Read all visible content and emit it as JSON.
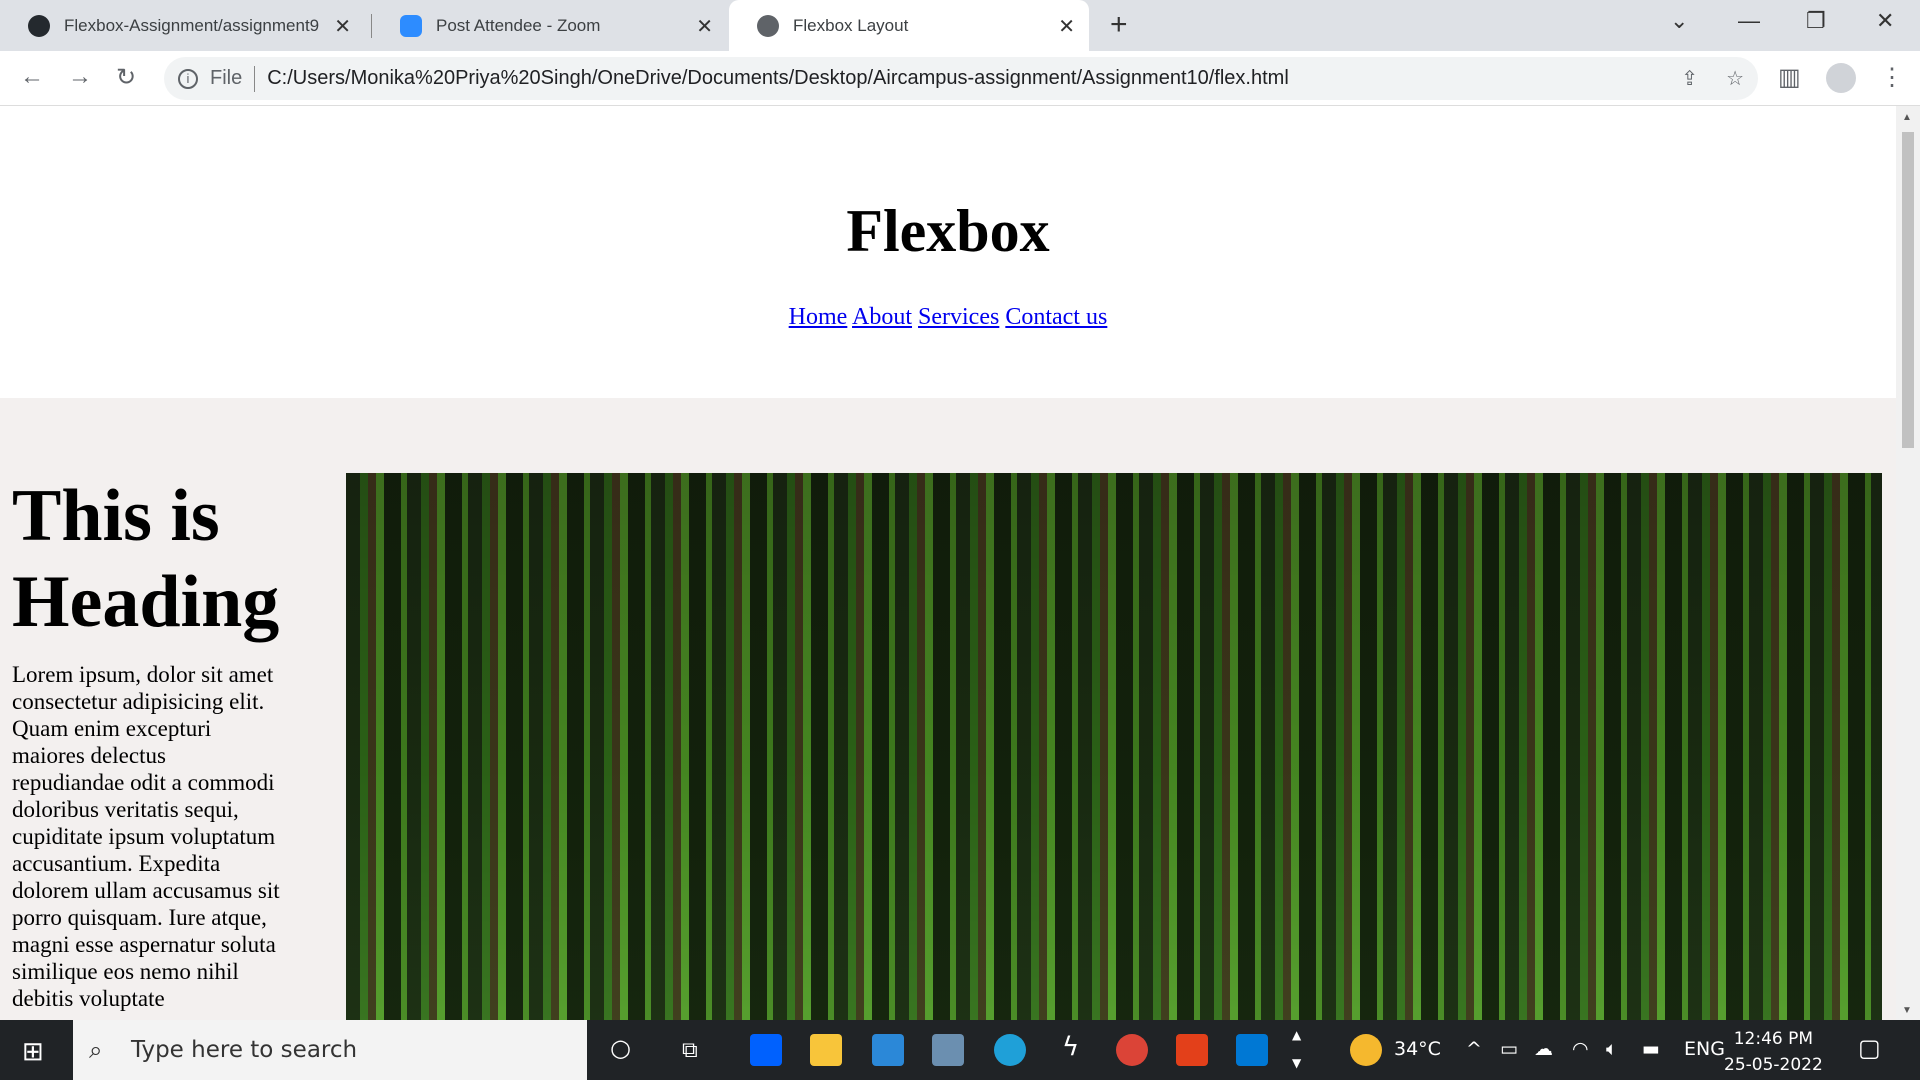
{
  "browser": {
    "tabs": [
      {
        "title": "Flexbox-Assignment/assignment9",
        "icon": "github-icon"
      },
      {
        "title": "Post Attendee - Zoom",
        "icon": "zoom-icon"
      },
      {
        "title": "Flexbox Layout",
        "icon": "globe-icon",
        "active": true
      }
    ],
    "url_scheme": "File",
    "url": "C:/Users/Monika%20Priya%20Singh/OneDrive/Documents/Desktop/Aircampus-assignment/Assignment10/flex.html"
  },
  "page": {
    "title": "Flexbox",
    "nav": [
      "Home",
      "About",
      "Services",
      "Contact us"
    ],
    "heading": "This is Heading",
    "paragraph": "Lorem ipsum, dolor sit amet consectetur adipisicing elit. Quam enim excepturi maiores delectus repudiandae odit a commodi doloribus veritatis sequi, cupiditate ipsum voluptatum accusantium. Expedita dolorem ullam accusamus sit porro quisquam. Iure atque, magni esse aspernatur soluta similique eos nemo nihil debitis voluptate"
  },
  "taskbar": {
    "search_placeholder": "Type here to search",
    "weather": "34°C",
    "language": "ENG",
    "time": "12:46 PM",
    "date": "25-05-2022"
  }
}
